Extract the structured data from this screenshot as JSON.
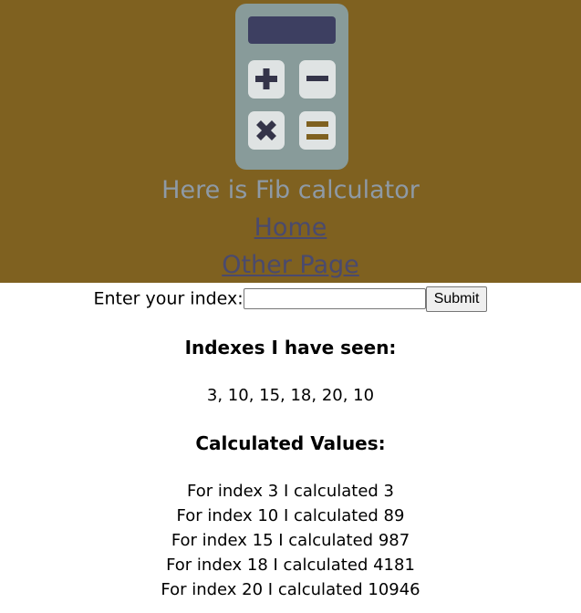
{
  "header": {
    "title": "Here is Fib calculator",
    "background_color": "#7f6120",
    "logo_icon": "calculator-icon",
    "nav": [
      {
        "label": "Home"
      },
      {
        "label": "Other Page"
      }
    ]
  },
  "form": {
    "label": "Enter your index:",
    "input_value": "",
    "submit_label": "Submit"
  },
  "indexes_section": {
    "heading": "Indexes I have seen:",
    "values_text": "3, 10, 15, 18, 20, 10"
  },
  "values_section": {
    "heading": "Calculated Values:",
    "items": [
      "For index 3 I calculated 3",
      "For index 10 I calculated 89",
      "For index 15 I calculated 987",
      "For index 18 I calculated 4181",
      "For index 20 I calculated 10946"
    ]
  }
}
